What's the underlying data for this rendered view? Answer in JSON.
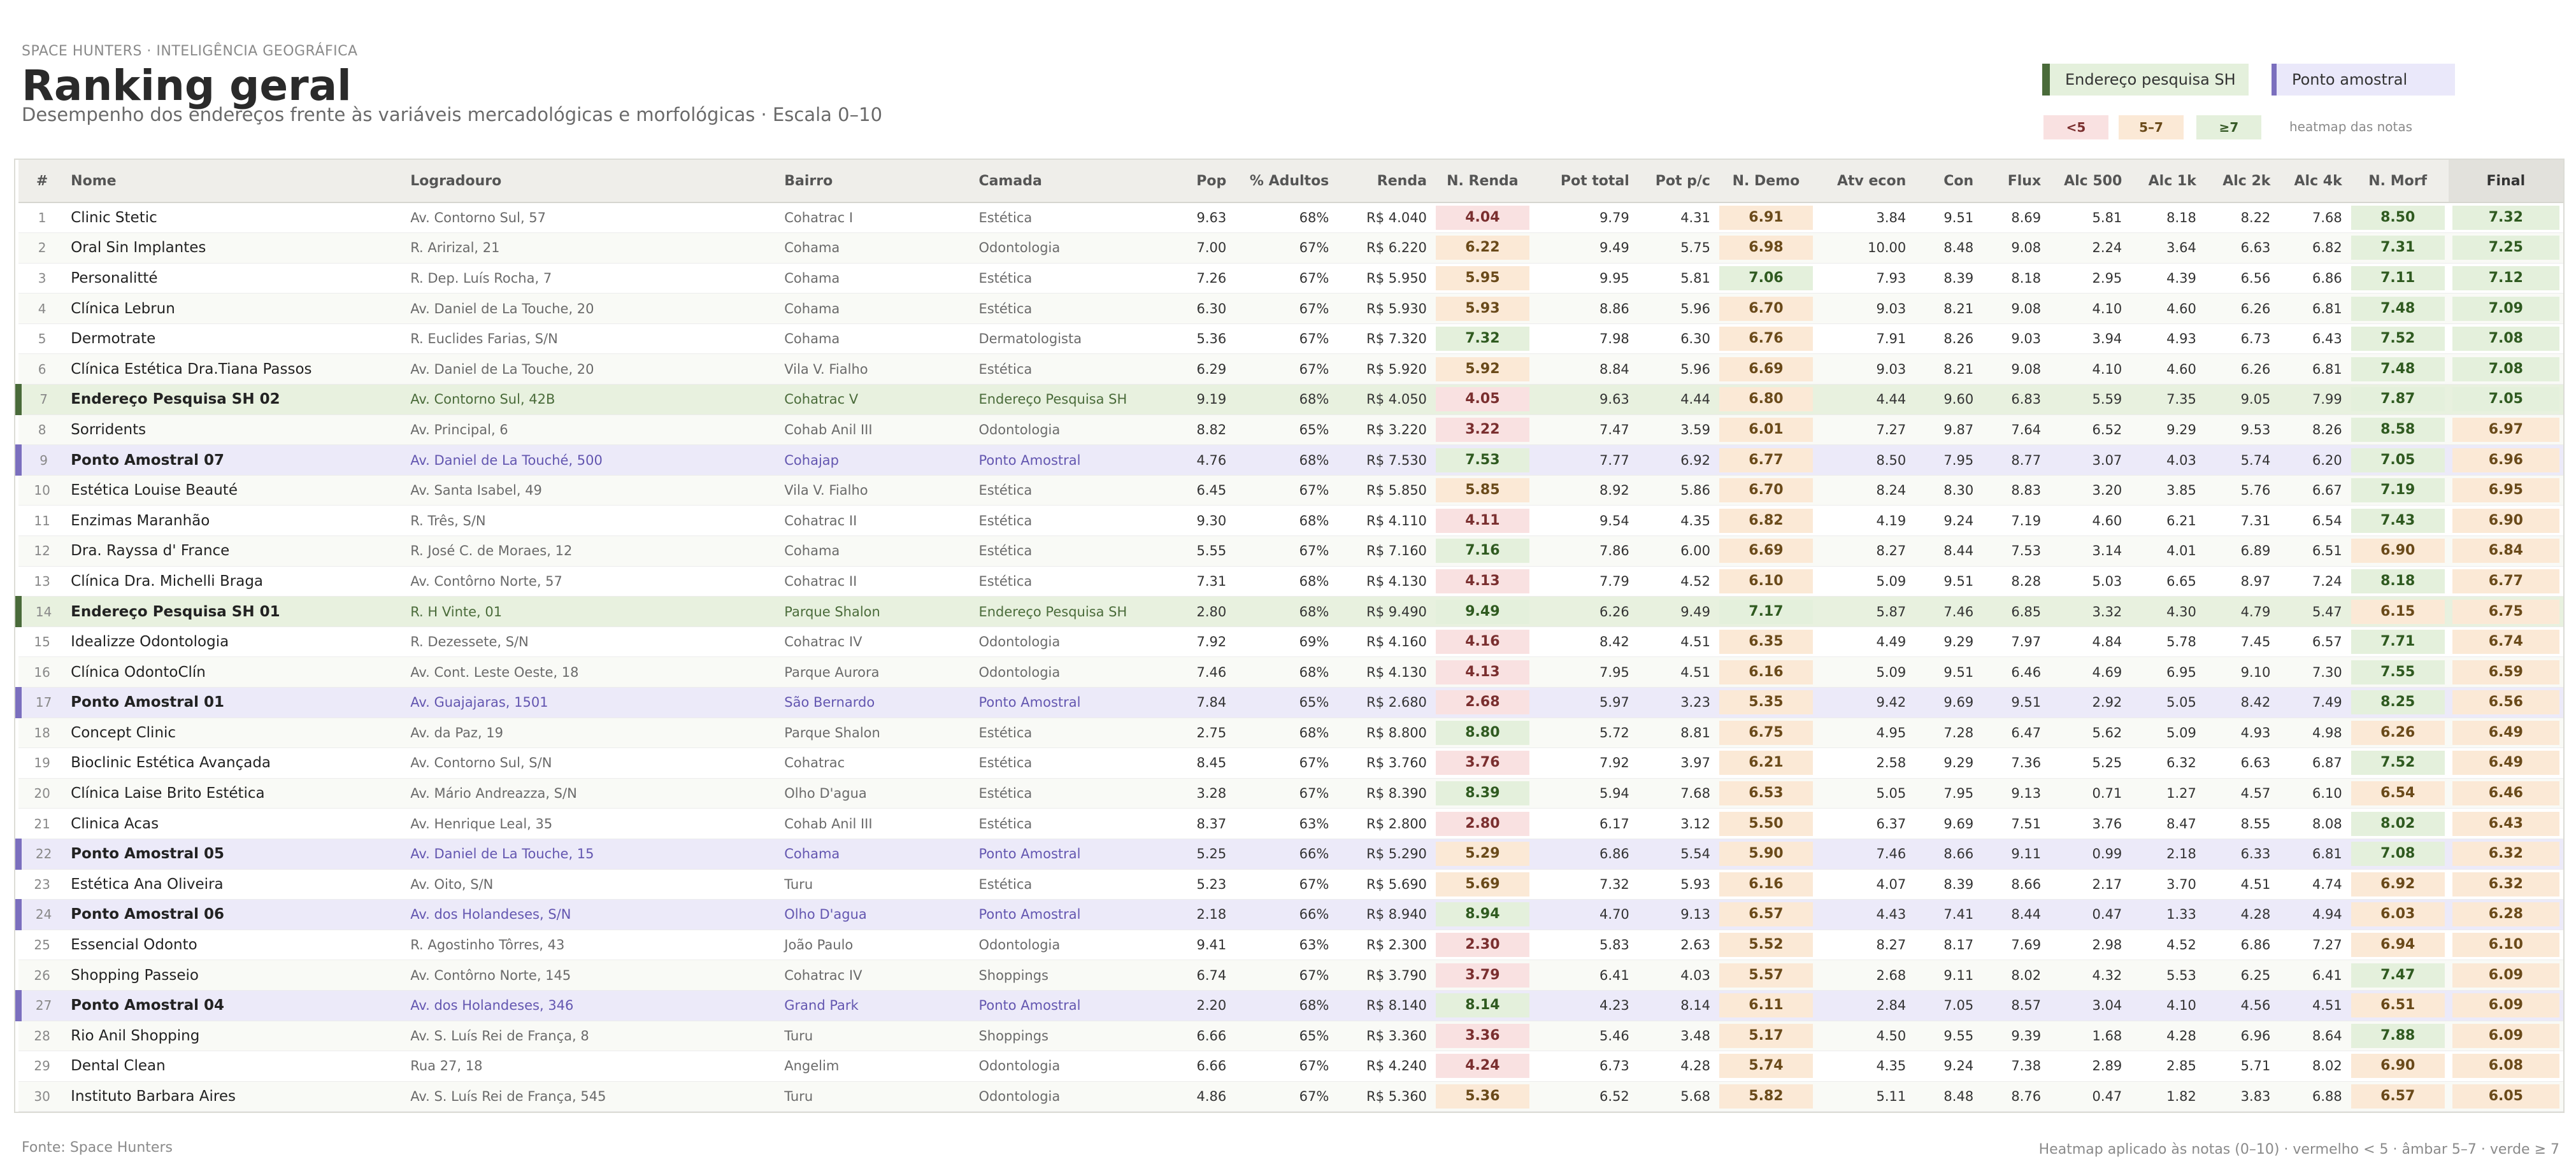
{
  "header": {
    "eyebrow": "SPACE HUNTERS  ·  INTELIGÊNCIA GEOGRÁFICA",
    "title": "Ranking geral",
    "subtitle": "Desempenho dos endereços frente às variáveis mercadológicas e morfológicas  ·  Escala 0–10"
  },
  "legend": {
    "sh_label": "Endereço pesquisa SH",
    "pa_label": "Ponto amostral",
    "chip_red": "<5",
    "chip_amber": "5–7",
    "chip_green": "≥7",
    "chip_note": "heatmap das notas",
    "colors": {
      "sh": "#4a6b3a",
      "pa": "#7b6fbe",
      "red": "#f9e1e1",
      "amber": "#fbe9d6",
      "green": "#e4f0dc"
    }
  },
  "table": {
    "columns": [
      "#",
      "Nome",
      "Logradouro",
      "Bairro",
      "Camada",
      "Pop",
      "% Adultos",
      "Renda",
      "N. Renda",
      "Pot total",
      "Pot p/c",
      "N. Demo",
      "Atv econ",
      "Con",
      "Flux",
      "Alc 500",
      "Alc 1k",
      "Alc 2k",
      "Alc 4k",
      "N. Morf",
      "Final"
    ],
    "rows": [
      {
        "rank": "1",
        "name": "Clinic Stetic",
        "addr": "Av. Contorno Sul, 57",
        "bairro": "Cohatrac I",
        "camada": "Estética",
        "pop": "9.63",
        "adultos": "68%",
        "renda": "R$ 4.040",
        "n_renda": "4.04",
        "pot_total": "9.79",
        "pot_pc": "4.31",
        "n_demo": "6.91",
        "atv": "3.84",
        "con": "9.51",
        "flux": "8.69",
        "a500": "5.81",
        "a1k": "8.18",
        "a2k": "8.22",
        "a4k": "7.68",
        "n_morf": "8.50",
        "final": "7.32",
        "type": "regular"
      },
      {
        "rank": "2",
        "name": "Oral Sin Implantes",
        "addr": "R. Aririzal, 21",
        "bairro": "Cohama",
        "camada": "Odontologia",
        "pop": "7.00",
        "adultos": "67%",
        "renda": "R$ 6.220",
        "n_renda": "6.22",
        "pot_total": "9.49",
        "pot_pc": "5.75",
        "n_demo": "6.98",
        "atv": "10.00",
        "con": "8.48",
        "flux": "9.08",
        "a500": "2.24",
        "a1k": "3.64",
        "a2k": "6.63",
        "a4k": "6.82",
        "n_morf": "7.31",
        "final": "7.25",
        "type": "regular"
      },
      {
        "rank": "3",
        "name": "Personalitté",
        "addr": "R. Dep. Luís Rocha, 7",
        "bairro": "Cohama",
        "camada": "Estética",
        "pop": "7.26",
        "adultos": "67%",
        "renda": "R$ 5.950",
        "n_renda": "5.95",
        "pot_total": "9.95",
        "pot_pc": "5.81",
        "n_demo": "7.06",
        "atv": "7.93",
        "con": "8.39",
        "flux": "8.18",
        "a500": "2.95",
        "a1k": "4.39",
        "a2k": "6.56",
        "a4k": "6.86",
        "n_morf": "7.11",
        "final": "7.12",
        "type": "regular"
      },
      {
        "rank": "4",
        "name": "Clínica Lebrun",
        "addr": "Av. Daniel de La Touche, 20",
        "bairro": "Cohama",
        "camada": "Estética",
        "pop": "6.30",
        "adultos": "67%",
        "renda": "R$ 5.930",
        "n_renda": "5.93",
        "pot_total": "8.86",
        "pot_pc": "5.96",
        "n_demo": "6.70",
        "atv": "9.03",
        "con": "8.21",
        "flux": "9.08",
        "a500": "4.10",
        "a1k": "4.60",
        "a2k": "6.26",
        "a4k": "6.81",
        "n_morf": "7.48",
        "final": "7.09",
        "type": "regular"
      },
      {
        "rank": "5",
        "name": "Dermotrate",
        "addr": "R. Euclides Farias, S/N",
        "bairro": "Cohama",
        "camada": "Dermatologista",
        "pop": "5.36",
        "adultos": "67%",
        "renda": "R$ 7.320",
        "n_renda": "7.32",
        "pot_total": "7.98",
        "pot_pc": "6.30",
        "n_demo": "6.76",
        "atv": "7.91",
        "con": "8.26",
        "flux": "9.03",
        "a500": "3.94",
        "a1k": "4.93",
        "a2k": "6.73",
        "a4k": "6.43",
        "n_morf": "7.52",
        "final": "7.08",
        "type": "regular"
      },
      {
        "rank": "6",
        "name": "Clínica Estética Dra.Tiana Passos",
        "addr": "Av. Daniel de La Touche, 20",
        "bairro": "Vila V. Fialho",
        "camada": "Estética",
        "pop": "6.29",
        "adultos": "67%",
        "renda": "R$ 5.920",
        "n_renda": "5.92",
        "pot_total": "8.84",
        "pot_pc": "5.96",
        "n_demo": "6.69",
        "atv": "9.03",
        "con": "8.21",
        "flux": "9.08",
        "a500": "4.10",
        "a1k": "4.60",
        "a2k": "6.26",
        "a4k": "6.81",
        "n_morf": "7.48",
        "final": "7.08",
        "type": "regular"
      },
      {
        "rank": "7",
        "name": "Endereço Pesquisa SH 02",
        "addr": "Av. Contorno Sul, 42B",
        "bairro": "Cohatrac V",
        "camada": "Endereço Pesquisa SH",
        "pop": "9.19",
        "adultos": "68%",
        "renda": "R$ 4.050",
        "n_renda": "4.05",
        "pot_total": "9.63",
        "pot_pc": "4.44",
        "n_demo": "6.80",
        "atv": "4.44",
        "con": "9.60",
        "flux": "6.83",
        "a500": "5.59",
        "a1k": "7.35",
        "a2k": "9.05",
        "a4k": "7.99",
        "n_morf": "7.87",
        "final": "7.05",
        "type": "sh"
      },
      {
        "rank": "8",
        "name": "Sorridents",
        "addr": "Av. Principal, 6",
        "bairro": "Cohab Anil III",
        "camada": "Odontologia",
        "pop": "8.82",
        "adultos": "65%",
        "renda": "R$ 3.220",
        "n_renda": "3.22",
        "pot_total": "7.47",
        "pot_pc": "3.59",
        "n_demo": "6.01",
        "atv": "7.27",
        "con": "9.87",
        "flux": "7.64",
        "a500": "6.52",
        "a1k": "9.29",
        "a2k": "9.53",
        "a4k": "8.26",
        "n_morf": "8.58",
        "final": "6.97",
        "type": "regular"
      },
      {
        "rank": "9",
        "name": "Ponto Amostral 07",
        "addr": "Av. Daniel de La Touché, 500",
        "bairro": "Cohajap",
        "camada": "Ponto Amostral",
        "pop": "4.76",
        "adultos": "68%",
        "renda": "R$ 7.530",
        "n_renda": "7.53",
        "pot_total": "7.77",
        "pot_pc": "6.92",
        "n_demo": "6.77",
        "atv": "8.50",
        "con": "7.95",
        "flux": "8.77",
        "a500": "3.07",
        "a1k": "4.03",
        "a2k": "5.74",
        "a4k": "6.20",
        "n_morf": "7.05",
        "final": "6.96",
        "type": "pa"
      },
      {
        "rank": "10",
        "name": "Estética Louise Beauté",
        "addr": "Av. Santa Isabel, 49",
        "bairro": "Vila V. Fialho",
        "camada": "Estética",
        "pop": "6.45",
        "adultos": "67%",
        "renda": "R$ 5.850",
        "n_renda": "5.85",
        "pot_total": "8.92",
        "pot_pc": "5.86",
        "n_demo": "6.70",
        "atv": "8.24",
        "con": "8.30",
        "flux": "8.83",
        "a500": "3.20",
        "a1k": "3.85",
        "a2k": "5.76",
        "a4k": "6.67",
        "n_morf": "7.19",
        "final": "6.95",
        "type": "regular"
      },
      {
        "rank": "11",
        "name": "Enzimas Maranhão",
        "addr": "R. Três, S/N",
        "bairro": "Cohatrac II",
        "camada": "Estética",
        "pop": "9.30",
        "adultos": "68%",
        "renda": "R$ 4.110",
        "n_renda": "4.11",
        "pot_total": "9.54",
        "pot_pc": "4.35",
        "n_demo": "6.82",
        "atv": "4.19",
        "con": "9.24",
        "flux": "7.19",
        "a500": "4.60",
        "a1k": "6.21",
        "a2k": "7.31",
        "a4k": "6.54",
        "n_morf": "7.43",
        "final": "6.90",
        "type": "regular"
      },
      {
        "rank": "12",
        "name": "Dra. Rayssa d' France",
        "addr": "R. José C. de Moraes, 12",
        "bairro": "Cohama",
        "camada": "Estética",
        "pop": "5.55",
        "adultos": "67%",
        "renda": "R$ 7.160",
        "n_renda": "7.16",
        "pot_total": "7.86",
        "pot_pc": "6.00",
        "n_demo": "6.69",
        "atv": "8.27",
        "con": "8.44",
        "flux": "7.53",
        "a500": "3.14",
        "a1k": "4.01",
        "a2k": "6.89",
        "a4k": "6.51",
        "n_morf": "6.90",
        "final": "6.84",
        "type": "regular"
      },
      {
        "rank": "13",
        "name": "Clínica Dra. Michelli Braga",
        "addr": "Av. Contôrno Norte, 57",
        "bairro": "Cohatrac II",
        "camada": "Estética",
        "pop": "7.31",
        "adultos": "68%",
        "renda": "R$ 4.130",
        "n_renda": "4.13",
        "pot_total": "7.79",
        "pot_pc": "4.52",
        "n_demo": "6.10",
        "atv": "5.09",
        "con": "9.51",
        "flux": "8.28",
        "a500": "5.03",
        "a1k": "6.65",
        "a2k": "8.97",
        "a4k": "7.24",
        "n_morf": "8.18",
        "final": "6.77",
        "type": "regular"
      },
      {
        "rank": "14",
        "name": "Endereço Pesquisa SH 01",
        "addr": "R. H Vinte, 01",
        "bairro": "Parque Shalon",
        "camada": "Endereço Pesquisa SH",
        "pop": "2.80",
        "adultos": "68%",
        "renda": "R$ 9.490",
        "n_renda": "9.49",
        "pot_total": "6.26",
        "pot_pc": "9.49",
        "n_demo": "7.17",
        "atv": "5.87",
        "con": "7.46",
        "flux": "6.85",
        "a500": "3.32",
        "a1k": "4.30",
        "a2k": "4.79",
        "a4k": "5.47",
        "n_morf": "6.15",
        "final": "6.75",
        "type": "sh"
      },
      {
        "rank": "15",
        "name": "Idealizze Odontologia",
        "addr": "R. Dezessete, S/N",
        "bairro": "Cohatrac IV",
        "camada": "Odontologia",
        "pop": "7.92",
        "adultos": "69%",
        "renda": "R$ 4.160",
        "n_renda": "4.16",
        "pot_total": "8.42",
        "pot_pc": "4.51",
        "n_demo": "6.35",
        "atv": "4.49",
        "con": "9.29",
        "flux": "7.97",
        "a500": "4.84",
        "a1k": "5.78",
        "a2k": "7.45",
        "a4k": "6.57",
        "n_morf": "7.71",
        "final": "6.74",
        "type": "regular"
      },
      {
        "rank": "16",
        "name": "Clínica OdontoClín",
        "addr": "Av. Cont. Leste Oeste, 18",
        "bairro": "Parque Aurora",
        "camada": "Odontologia",
        "pop": "7.46",
        "adultos": "68%",
        "renda": "R$ 4.130",
        "n_renda": "4.13",
        "pot_total": "7.95",
        "pot_pc": "4.51",
        "n_demo": "6.16",
        "atv": "5.09",
        "con": "9.51",
        "flux": "6.46",
        "a500": "4.69",
        "a1k": "6.95",
        "a2k": "9.10",
        "a4k": "7.30",
        "n_morf": "7.55",
        "final": "6.59",
        "type": "regular"
      },
      {
        "rank": "17",
        "name": "Ponto Amostral 01",
        "addr": "Av. Guajajaras, 1501",
        "bairro": "São Bernardo",
        "camada": "Ponto Amostral",
        "pop": "7.84",
        "adultos": "65%",
        "renda": "R$ 2.680",
        "n_renda": "2.68",
        "pot_total": "5.97",
        "pot_pc": "3.23",
        "n_demo": "5.35",
        "atv": "9.42",
        "con": "9.69",
        "flux": "9.51",
        "a500": "2.92",
        "a1k": "5.05",
        "a2k": "8.42",
        "a4k": "7.49",
        "n_morf": "8.25",
        "final": "6.56",
        "type": "pa"
      },
      {
        "rank": "18",
        "name": "Concept Clinic",
        "addr": "Av. da Paz, 19",
        "bairro": "Parque Shalon",
        "camada": "Estética",
        "pop": "2.75",
        "adultos": "68%",
        "renda": "R$ 8.800",
        "n_renda": "8.80",
        "pot_total": "5.72",
        "pot_pc": "8.81",
        "n_demo": "6.75",
        "atv": "4.95",
        "con": "7.28",
        "flux": "6.47",
        "a500": "5.62",
        "a1k": "5.09",
        "a2k": "4.93",
        "a4k": "4.98",
        "n_morf": "6.26",
        "final": "6.49",
        "type": "regular"
      },
      {
        "rank": "19",
        "name": "Bioclinic Estética Avançada",
        "addr": "Av. Contorno Sul, S/N",
        "bairro": "Cohatrac",
        "camada": "Estética",
        "pop": "8.45",
        "adultos": "67%",
        "renda": "R$ 3.760",
        "n_renda": "3.76",
        "pot_total": "7.92",
        "pot_pc": "3.97",
        "n_demo": "6.21",
        "atv": "2.58",
        "con": "9.29",
        "flux": "7.36",
        "a500": "5.25",
        "a1k": "6.32",
        "a2k": "6.63",
        "a4k": "6.87",
        "n_morf": "7.52",
        "final": "6.49",
        "type": "regular"
      },
      {
        "rank": "20",
        "name": "Clínica Laise Brito Estética",
        "addr": "Av. Mário Andreazza, S/N",
        "bairro": "Olho D'agua",
        "camada": "Estética",
        "pop": "3.28",
        "adultos": "67%",
        "renda": "R$ 8.390",
        "n_renda": "8.39",
        "pot_total": "5.94",
        "pot_pc": "7.68",
        "n_demo": "6.53",
        "atv": "5.05",
        "con": "7.95",
        "flux": "9.13",
        "a500": "0.71",
        "a1k": "1.27",
        "a2k": "4.57",
        "a4k": "6.10",
        "n_morf": "6.54",
        "final": "6.46",
        "type": "regular"
      },
      {
        "rank": "21",
        "name": "Clinica Acas",
        "addr": "Av. Henrique Leal, 35",
        "bairro": "Cohab Anil III",
        "camada": "Estética",
        "pop": "8.37",
        "adultos": "63%",
        "renda": "R$ 2.800",
        "n_renda": "2.80",
        "pot_total": "6.17",
        "pot_pc": "3.12",
        "n_demo": "5.50",
        "atv": "6.37",
        "con": "9.69",
        "flux": "7.51",
        "a500": "3.76",
        "a1k": "8.47",
        "a2k": "8.55",
        "a4k": "8.08",
        "n_morf": "8.02",
        "final": "6.43",
        "type": "regular"
      },
      {
        "rank": "22",
        "name": "Ponto Amostral 05",
        "addr": "Av. Daniel de La Touche, 15",
        "bairro": "Cohama",
        "camada": "Ponto Amostral",
        "pop": "5.25",
        "adultos": "66%",
        "renda": "R$ 5.290",
        "n_renda": "5.29",
        "pot_total": "6.86",
        "pot_pc": "5.54",
        "n_demo": "5.90",
        "atv": "7.46",
        "con": "8.66",
        "flux": "9.11",
        "a500": "0.99",
        "a1k": "2.18",
        "a2k": "6.33",
        "a4k": "6.81",
        "n_morf": "7.08",
        "final": "6.32",
        "type": "pa"
      },
      {
        "rank": "23",
        "name": "Estética Ana Oliveira",
        "addr": "Av. Oito, S/N",
        "bairro": "Turu",
        "camada": "Estética",
        "pop": "5.23",
        "adultos": "67%",
        "renda": "R$ 5.690",
        "n_renda": "5.69",
        "pot_total": "7.32",
        "pot_pc": "5.93",
        "n_demo": "6.16",
        "atv": "4.07",
        "con": "8.39",
        "flux": "8.66",
        "a500": "2.17",
        "a1k": "3.70",
        "a2k": "4.51",
        "a4k": "4.74",
        "n_morf": "6.92",
        "final": "6.32",
        "type": "regular"
      },
      {
        "rank": "24",
        "name": "Ponto Amostral 06",
        "addr": "Av. dos Holandeses, S/N",
        "bairro": "Olho D'agua",
        "camada": "Ponto Amostral",
        "pop": "2.18",
        "adultos": "66%",
        "renda": "R$ 8.940",
        "n_renda": "8.94",
        "pot_total": "4.70",
        "pot_pc": "9.13",
        "n_demo": "6.57",
        "atv": "4.43",
        "con": "7.41",
        "flux": "8.44",
        "a500": "0.47",
        "a1k": "1.33",
        "a2k": "4.28",
        "a4k": "4.94",
        "n_morf": "6.03",
        "final": "6.28",
        "type": "pa"
      },
      {
        "rank": "25",
        "name": "Essencial Odonto",
        "addr": "R. Agostinho Tôrres, 43",
        "bairro": "João Paulo",
        "camada": "Odontologia",
        "pop": "9.41",
        "adultos": "63%",
        "renda": "R$ 2.300",
        "n_renda": "2.30",
        "pot_total": "5.83",
        "pot_pc": "2.63",
        "n_demo": "5.52",
        "atv": "8.27",
        "con": "8.17",
        "flux": "7.69",
        "a500": "2.98",
        "a1k": "4.52",
        "a2k": "6.86",
        "a4k": "7.27",
        "n_morf": "6.94",
        "final": "6.10",
        "type": "regular"
      },
      {
        "rank": "26",
        "name": "Shopping Passeio",
        "addr": "Av. Contôrno Norte, 145",
        "bairro": "Cohatrac IV",
        "camada": "Shoppings",
        "pop": "6.74",
        "adultos": "67%",
        "renda": "R$ 3.790",
        "n_renda": "3.79",
        "pot_total": "6.41",
        "pot_pc": "4.03",
        "n_demo": "5.57",
        "atv": "2.68",
        "con": "9.11",
        "flux": "8.02",
        "a500": "4.32",
        "a1k": "5.53",
        "a2k": "6.25",
        "a4k": "6.41",
        "n_morf": "7.47",
        "final": "6.09",
        "type": "regular"
      },
      {
        "rank": "27",
        "name": "Ponto Amostral 04",
        "addr": "Av. dos Holandeses, 346",
        "bairro": "Grand Park",
        "camada": "Ponto Amostral",
        "pop": "2.20",
        "adultos": "68%",
        "renda": "R$ 8.140",
        "n_renda": "8.14",
        "pot_total": "4.23",
        "pot_pc": "8.14",
        "n_demo": "6.11",
        "atv": "2.84",
        "con": "7.05",
        "flux": "8.57",
        "a500": "3.04",
        "a1k": "4.10",
        "a2k": "4.56",
        "a4k": "4.51",
        "n_morf": "6.51",
        "final": "6.09",
        "type": "pa"
      },
      {
        "rank": "28",
        "name": "Rio Anil Shopping",
        "addr": "Av. S. Luís Rei de França, 8",
        "bairro": "Turu",
        "camada": "Shoppings",
        "pop": "6.66",
        "adultos": "65%",
        "renda": "R$ 3.360",
        "n_renda": "3.36",
        "pot_total": "5.46",
        "pot_pc": "3.48",
        "n_demo": "5.17",
        "atv": "4.50",
        "con": "9.55",
        "flux": "9.39",
        "a500": "1.68",
        "a1k": "4.28",
        "a2k": "6.96",
        "a4k": "8.64",
        "n_morf": "7.88",
        "final": "6.09",
        "type": "regular"
      },
      {
        "rank": "29",
        "name": "Dental Clean",
        "addr": "Rua 27, 18",
        "bairro": "Angelim",
        "camada": "Odontologia",
        "pop": "6.66",
        "adultos": "67%",
        "renda": "R$ 4.240",
        "n_renda": "4.24",
        "pot_total": "6.73",
        "pot_pc": "4.28",
        "n_demo": "5.74",
        "atv": "4.35",
        "con": "9.24",
        "flux": "7.38",
        "a500": "2.89",
        "a1k": "2.85",
        "a2k": "5.71",
        "a4k": "8.02",
        "n_morf": "6.90",
        "final": "6.08",
        "type": "regular"
      },
      {
        "rank": "30",
        "name": "Instituto Barbara Aires",
        "addr": "Av. S. Luís Rei de França, 545",
        "bairro": "Turu",
        "camada": "Odontologia",
        "pop": "4.86",
        "adultos": "67%",
        "renda": "R$ 5.360",
        "n_renda": "5.36",
        "pot_total": "6.52",
        "pot_pc": "5.68",
        "n_demo": "5.82",
        "atv": "5.11",
        "con": "8.48",
        "flux": "8.76",
        "a500": "0.47",
        "a1k": "1.82",
        "a2k": "3.83",
        "a4k": "6.88",
        "n_morf": "6.57",
        "final": "6.05",
        "type": "regular"
      }
    ]
  },
  "footer": {
    "source": "Fonte: Space Hunters",
    "note": "Heatmap aplicado às notas (0–10)  ·  vermelho < 5  ·  âmbar 5–7  ·  verde ≥ 7"
  }
}
